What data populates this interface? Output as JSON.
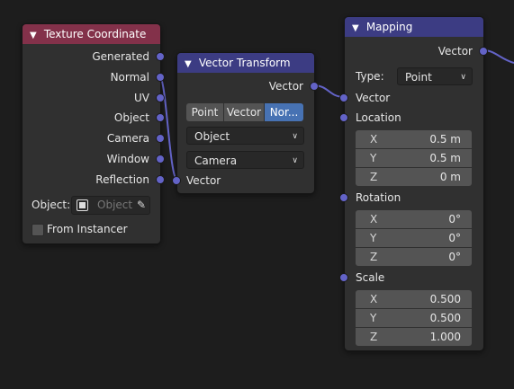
{
  "colors": {
    "socket": "#6363c7",
    "link": "#6363c7",
    "texcoord_header": "#83314a",
    "vector_header": "#3c3c83",
    "active_segment": "#4772b3"
  },
  "icons": {
    "collapse": "chevron-down-icon",
    "object": "object-square-icon",
    "eyedropper": "eyedropper-icon",
    "dropdown": "chevron-down-icon"
  },
  "tex_coord": {
    "title": "Texture Coordinate",
    "outputs": [
      "Generated",
      "Normal",
      "UV",
      "Object",
      "Camera",
      "Window",
      "Reflection"
    ],
    "object_label": "Object:",
    "object_placeholder": "Object",
    "from_instancer": "From Instancer",
    "from_instancer_checked": false
  },
  "vector_transform": {
    "title": "Vector Transform",
    "output": "Vector",
    "segments": [
      "Point",
      "Vector",
      "Nor..."
    ],
    "active_segment": "Nor...",
    "convert_from": "Object",
    "convert_to": "Camera",
    "input": "Vector"
  },
  "mapping": {
    "title": "Mapping",
    "output": "Vector",
    "type_label": "Type:",
    "type_value": "Point",
    "vector_input": "Vector",
    "location_label": "Location",
    "location": [
      {
        "axis": "X",
        "value": "0.5 m"
      },
      {
        "axis": "Y",
        "value": "0.5 m"
      },
      {
        "axis": "Z",
        "value": "0 m"
      }
    ],
    "rotation_label": "Rotation",
    "rotation": [
      {
        "axis": "X",
        "value": "0°"
      },
      {
        "axis": "Y",
        "value": "0°"
      },
      {
        "axis": "Z",
        "value": "0°"
      }
    ],
    "scale_label": "Scale",
    "scale": [
      {
        "axis": "X",
        "value": "0.500"
      },
      {
        "axis": "Y",
        "value": "0.500"
      },
      {
        "axis": "Z",
        "value": "1.000"
      }
    ]
  }
}
